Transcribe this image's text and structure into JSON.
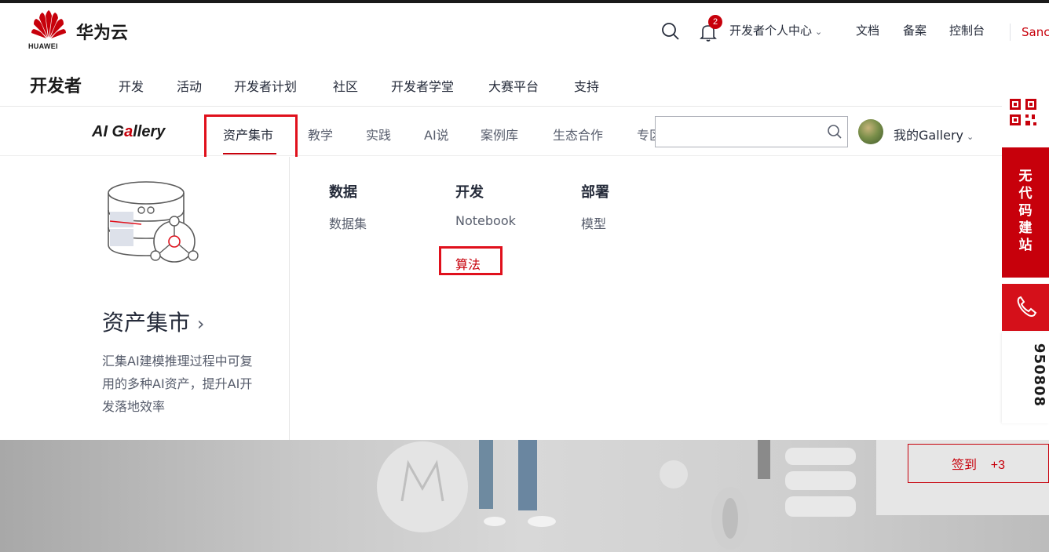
{
  "header": {
    "brand": "华为云",
    "logo_text": "HUAWEI",
    "notification_count": "2",
    "dev_center": "开发者个人中心",
    "docs": "文档",
    "filing": "备案",
    "console": "控制台",
    "user_partial": "Sanc"
  },
  "dev_nav": {
    "title": "开发者",
    "items": [
      "开发",
      "活动",
      "开发者计划",
      "社区",
      "开发者学堂",
      "大赛平台",
      "支持"
    ]
  },
  "gallery_nav": {
    "logo_prefix": "AI G",
    "logo_g": "a",
    "logo_suffix": "llery",
    "items": [
      "资产集市",
      "教学",
      "实践",
      "AI说",
      "案例库",
      "生态合作",
      "专区"
    ],
    "active_index": 0,
    "search_placeholder": "",
    "my_gallery": "我的Gallery"
  },
  "dropdown": {
    "title": "资产集市",
    "title_arrow": "›",
    "description": "汇集AI建模推理过程中可复用的多种AI资产，提升AI开发落地效率",
    "columns": [
      {
        "heading": "数据",
        "items": [
          "数据集"
        ]
      },
      {
        "heading": "开发",
        "items": [
          "Notebook",
          "算法"
        ]
      },
      {
        "heading": "部署",
        "items": [
          "模型"
        ]
      }
    ]
  },
  "sidebar": {
    "no_code": "无代码建站",
    "phone": "950808"
  },
  "banner": {
    "checkin": "签到",
    "checkin_points": "+3"
  },
  "colors": {
    "brand_red": "#c7000b",
    "highlight_red": "#e0101c",
    "text": "#252b3a",
    "muted": "#575d6c"
  }
}
